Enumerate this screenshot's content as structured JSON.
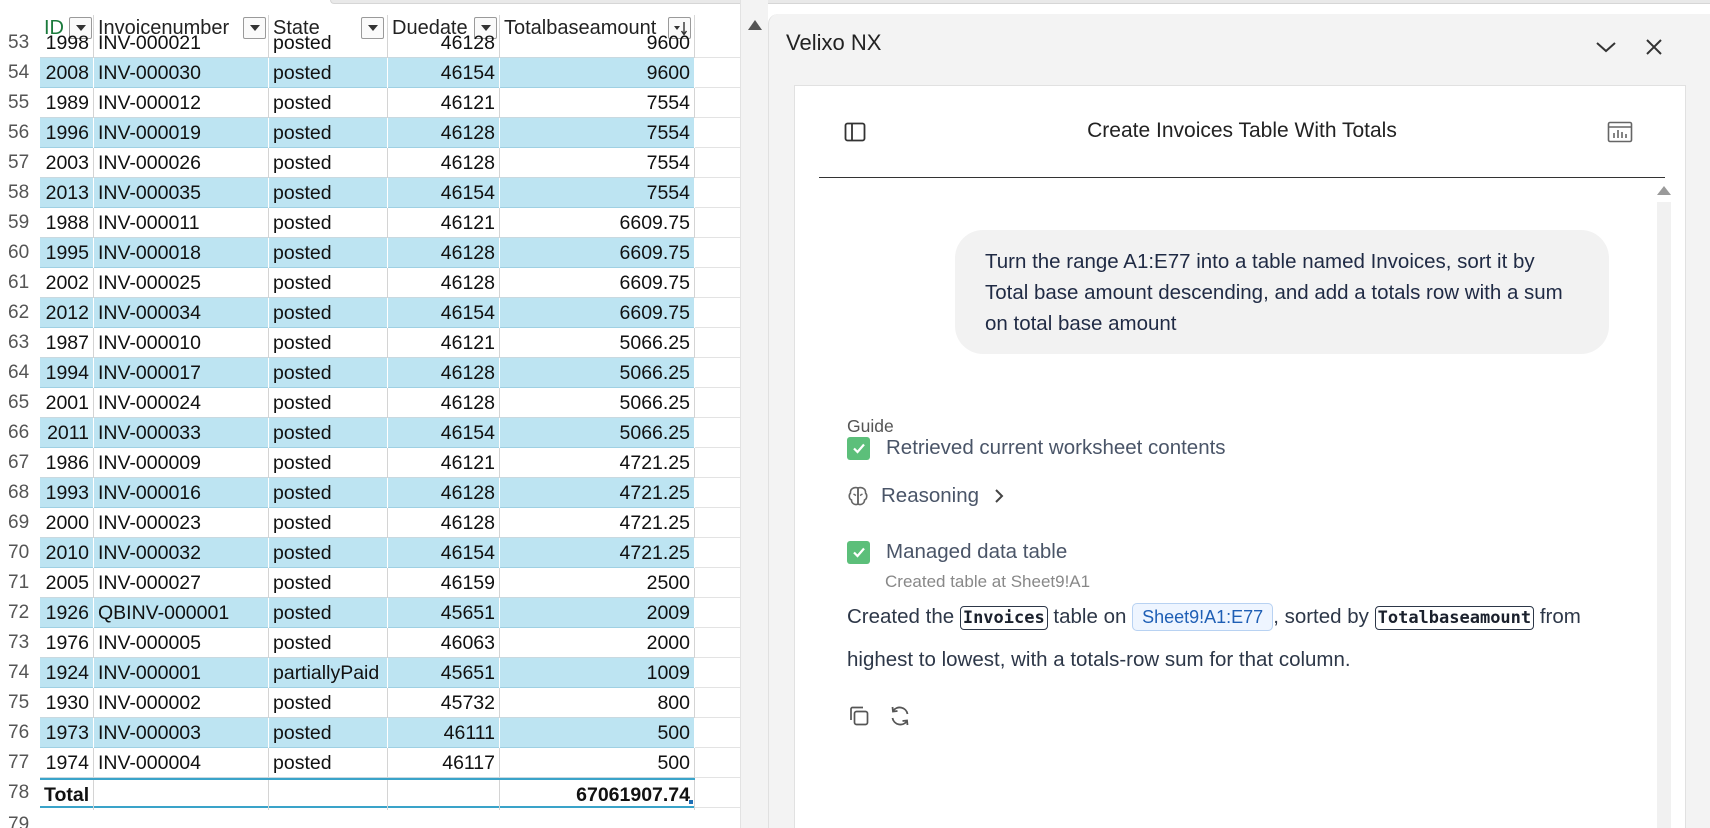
{
  "sheet": {
    "columns": [
      {
        "key": "id",
        "label": "ID"
      },
      {
        "key": "invoicenumber",
        "label": "Invoicenumber"
      },
      {
        "key": "state",
        "label": "State"
      },
      {
        "key": "duedate",
        "label": "Duedate"
      },
      {
        "key": "totalbaseamount",
        "label": "Totalbaseamount"
      }
    ],
    "rows": [
      {
        "n": "53",
        "id": "1998",
        "inv": "INV-000021",
        "state": "posted",
        "due": "46128",
        "amt": "9600",
        "band": false
      },
      {
        "n": "54",
        "id": "2008",
        "inv": "INV-000030",
        "state": "posted",
        "due": "46154",
        "amt": "9600",
        "band": true
      },
      {
        "n": "55",
        "id": "1989",
        "inv": "INV-000012",
        "state": "posted",
        "due": "46121",
        "amt": "7554",
        "band": false
      },
      {
        "n": "56",
        "id": "1996",
        "inv": "INV-000019",
        "state": "posted",
        "due": "46128",
        "amt": "7554",
        "band": true
      },
      {
        "n": "57",
        "id": "2003",
        "inv": "INV-000026",
        "state": "posted",
        "due": "46128",
        "amt": "7554",
        "band": false
      },
      {
        "n": "58",
        "id": "2013",
        "inv": "INV-000035",
        "state": "posted",
        "due": "46154",
        "amt": "7554",
        "band": true
      },
      {
        "n": "59",
        "id": "1988",
        "inv": "INV-000011",
        "state": "posted",
        "due": "46121",
        "amt": "6609.75",
        "band": false
      },
      {
        "n": "60",
        "id": "1995",
        "inv": "INV-000018",
        "state": "posted",
        "due": "46128",
        "amt": "6609.75",
        "band": true
      },
      {
        "n": "61",
        "id": "2002",
        "inv": "INV-000025",
        "state": "posted",
        "due": "46128",
        "amt": "6609.75",
        "band": false
      },
      {
        "n": "62",
        "id": "2012",
        "inv": "INV-000034",
        "state": "posted",
        "due": "46154",
        "amt": "6609.75",
        "band": true
      },
      {
        "n": "63",
        "id": "1987",
        "inv": "INV-000010",
        "state": "posted",
        "due": "46121",
        "amt": "5066.25",
        "band": false
      },
      {
        "n": "64",
        "id": "1994",
        "inv": "INV-000017",
        "state": "posted",
        "due": "46128",
        "amt": "5066.25",
        "band": true
      },
      {
        "n": "65",
        "id": "2001",
        "inv": "INV-000024",
        "state": "posted",
        "due": "46128",
        "amt": "5066.25",
        "band": false
      },
      {
        "n": "66",
        "id": "2011",
        "inv": "INV-000033",
        "state": "posted",
        "due": "46154",
        "amt": "5066.25",
        "band": true
      },
      {
        "n": "67",
        "id": "1986",
        "inv": "INV-000009",
        "state": "posted",
        "due": "46121",
        "amt": "4721.25",
        "band": false
      },
      {
        "n": "68",
        "id": "1993",
        "inv": "INV-000016",
        "state": "posted",
        "due": "46128",
        "amt": "4721.25",
        "band": true
      },
      {
        "n": "69",
        "id": "2000",
        "inv": "INV-000023",
        "state": "posted",
        "due": "46128",
        "amt": "4721.25",
        "band": false
      },
      {
        "n": "70",
        "id": "2010",
        "inv": "INV-000032",
        "state": "posted",
        "due": "46154",
        "amt": "4721.25",
        "band": true
      },
      {
        "n": "71",
        "id": "2005",
        "inv": "INV-000027",
        "state": "posted",
        "due": "46159",
        "amt": "2500",
        "band": false
      },
      {
        "n": "72",
        "id": "1926",
        "inv": "QBINV-000001",
        "state": "posted",
        "due": "45651",
        "amt": "2009",
        "band": true
      },
      {
        "n": "73",
        "id": "1976",
        "inv": "INV-000005",
        "state": "posted",
        "due": "46063",
        "amt": "2000",
        "band": false
      },
      {
        "n": "74",
        "id": "1924",
        "inv": "INV-000001",
        "state": "partiallyPaid",
        "due": "45651",
        "amt": "1009",
        "band": true
      },
      {
        "n": "75",
        "id": "1930",
        "inv": "INV-000002",
        "state": "posted",
        "due": "45732",
        "amt": "800",
        "band": false
      },
      {
        "n": "76",
        "id": "1973",
        "inv": "INV-000003",
        "state": "posted",
        "due": "46111",
        "amt": "500",
        "band": true
      },
      {
        "n": "77",
        "id": "1974",
        "inv": "INV-000004",
        "state": "posted",
        "due": "46117",
        "amt": "500",
        "band": false
      }
    ],
    "total_row": {
      "n": "78",
      "label": "Total",
      "amount": "67061907.74"
    },
    "last_row_num": "79"
  },
  "panel": {
    "title": "Velixo NX",
    "chat_title": "Create Invoices Table With Totals",
    "user_message": "Turn the range A1:E77 into a table named Invoices, sort it by Total base amount descending, and add a totals row with a sum on total base amount",
    "guide_label": "Guide",
    "steps": [
      {
        "label": "Retrieved current worksheet contents",
        "done": true
      },
      {
        "label": "Reasoning"
      },
      {
        "label": "Managed data table",
        "sub": "Created table at Sheet9!A1",
        "done": true
      }
    ],
    "result": {
      "t1": "Created the",
      "table_name": "Invoices",
      "t2": "table on",
      "range": "Sheet9!A1:E77",
      "t3": ", sorted by",
      "column": "Totalbaseamount",
      "t4": "from highest to lowest, with a totals-row sum for that column."
    }
  },
  "colors": {
    "band": "#bde4f2",
    "check": "#5cbf7a",
    "id_header": "#1b7a3c",
    "range_chip": "#1f5fb5"
  }
}
